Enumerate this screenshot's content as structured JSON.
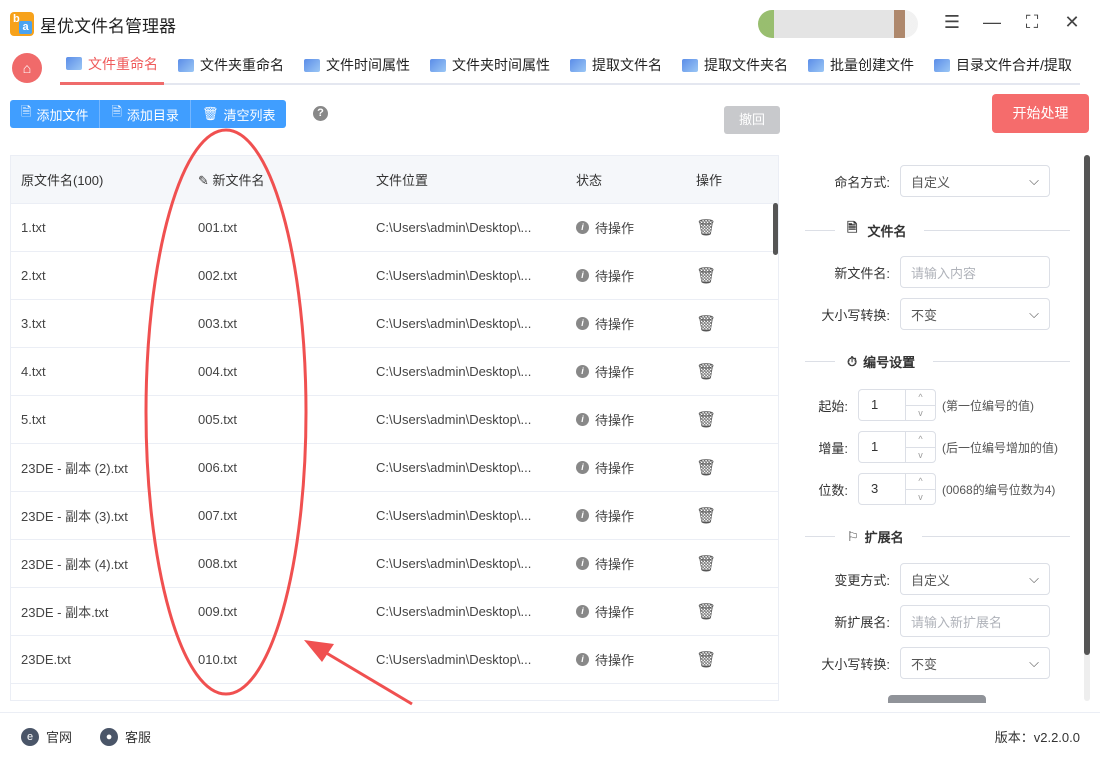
{
  "app": {
    "title": "星优文件名管理器"
  },
  "tabs": [
    {
      "label": "文件重命名"
    },
    {
      "label": "文件夹重命名"
    },
    {
      "label": "文件时间属性"
    },
    {
      "label": "文件夹时间属性"
    },
    {
      "label": "提取文件名"
    },
    {
      "label": "提取文件夹名"
    },
    {
      "label": "批量创建文件"
    },
    {
      "label": "目录文件合并/提取"
    }
  ],
  "toolbar": {
    "add_file": "添加文件",
    "add_dir": "添加目录",
    "clear": "清空列表",
    "undo": "撤回",
    "start": "开始处理"
  },
  "table": {
    "headers": [
      "原文件名(100)",
      "新文件名",
      "文件位置",
      "状态",
      "操作"
    ],
    "rows": [
      {
        "orig": "1.txt",
        "new": "001.txt",
        "path": "C:\\Users\\admin\\Desktop\\...",
        "status": "待操作"
      },
      {
        "orig": "2.txt",
        "new": "002.txt",
        "path": "C:\\Users\\admin\\Desktop\\...",
        "status": "待操作"
      },
      {
        "orig": "3.txt",
        "new": "003.txt",
        "path": "C:\\Users\\admin\\Desktop\\...",
        "status": "待操作"
      },
      {
        "orig": "4.txt",
        "new": "004.txt",
        "path": "C:\\Users\\admin\\Desktop\\...",
        "status": "待操作"
      },
      {
        "orig": "5.txt",
        "new": "005.txt",
        "path": "C:\\Users\\admin\\Desktop\\...",
        "status": "待操作"
      },
      {
        "orig": "23DE - 副本 (2).txt",
        "new": "006.txt",
        "path": "C:\\Users\\admin\\Desktop\\...",
        "status": "待操作"
      },
      {
        "orig": "23DE - 副本 (3).txt",
        "new": "007.txt",
        "path": "C:\\Users\\admin\\Desktop\\...",
        "status": "待操作"
      },
      {
        "orig": "23DE - 副本 (4).txt",
        "new": "008.txt",
        "path": "C:\\Users\\admin\\Desktop\\...",
        "status": "待操作"
      },
      {
        "orig": "23DE - 副本.txt",
        "new": "009.txt",
        "path": "C:\\Users\\admin\\Desktop\\...",
        "status": "待操作"
      },
      {
        "orig": "23DE.txt",
        "new": "010.txt",
        "path": "C:\\Users\\admin\\Desktop\\...",
        "status": "待操作"
      }
    ]
  },
  "panel": {
    "naming_label": "命名方式:",
    "naming_value": "自定义",
    "filename_section": "文件名",
    "new_name_label": "新文件名:",
    "new_name_placeholder": "请输入内容",
    "case_label": "大小写转换:",
    "case_value": "不变",
    "number_section": "编号设置",
    "start_label": "起始:",
    "start_value": "1",
    "start_hint": "(第一位编号的值)",
    "inc_label": "增量:",
    "inc_value": "1",
    "inc_hint": "(后一位编号增加的值)",
    "digits_label": "位数:",
    "digits_value": "3",
    "digits_hint": "(0068的编号位数为4)",
    "ext_section": "扩展名",
    "ext_mode_label": "变更方式:",
    "ext_mode_value": "自定义",
    "new_ext_label": "新扩展名:",
    "new_ext_placeholder": "请输入新扩展名",
    "ext_case_label": "大小写转换:",
    "ext_case_value": "不变"
  },
  "footer": {
    "website": "官网",
    "support": "客服",
    "version": "版本：v2.2.0.0"
  },
  "colors": {
    "accent": "#409eff",
    "danger": "#f56c6c",
    "annotation": "#f05050"
  }
}
